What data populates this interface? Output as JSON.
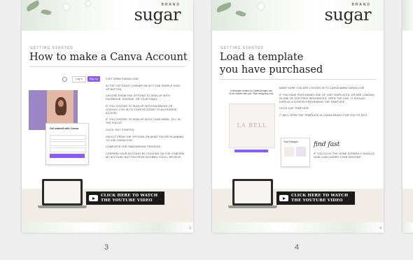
{
  "brand": {
    "small": "BRAND",
    "big": "sugar"
  },
  "pages": [
    {
      "number": "3",
      "section": "GETTING STARTED",
      "title": "How to make a Canva Account",
      "ui_login": "Log in",
      "ui_signup": "Sign up",
      "modal_title": "Get started with Canva",
      "steps": [
        "VISIT WWW.CANVA.COM",
        "IN THE TOP RIGHT CORNER SELECT THE PURPLE SIGN UP BUTTON",
        "CHOOSE FROM THE OPTIONS TO SIGN UP WITH FACEBOOK, GOOGLE, OR YOUR EMAIL",
        "IF YOU CHOOSE TO SIGN UP WITH FACEBOOK OR GOOGLE, LOG IN TO YOUR ACCOUNT TO AUTHORIZE ACCESS",
        "IF YOU CHOOSE TO SIGN UP WITH YOUR EMAIL, FILL IN THE FIELDS",
        "CLICK 'GET STARTED'",
        "SELECT FROM THE OPTIONS ON WHAT YOU'RE PLANNING TO USE CANVA FOR",
        "COMPLETE THE ONBOARDING PROCESS",
        "CONFIRM YOUR ACCOUNT BY CLICKING ON THE CONFIRM MY ACCOUNT BUTTON FROM AN EMAIL YOU'LL RECEIVE"
      ],
      "video_line1": "CLICK HERE TO WATCH",
      "video_line2": "THE YOUTUBE VIDEO",
      "corner": "3"
    },
    {
      "number": "4",
      "section": "GETTING STARTED",
      "title_line1": "Load a template",
      "title_line2": "you have purchased",
      "template_note": "A template created by SubtleDesigns can do an shared with you. Start designing now.",
      "template_logo": "LA BELL",
      "your_designs": "Your Designs",
      "script_text": "find fast",
      "steps": [
        "MAKE SURE YOU ARE LOGGED IN TO CANVA WWW.CANVA.COM",
        "IF YOU HAVE PURCHASED ONE OF OUR TEMPLATES, OR ARE LOADING IN ONE OF OUR FREE RESOURCES, OPEN THE LINK. IT SHOULD DISPLAY A SCREEN PREVIEWING THE TEMPLATE",
        "CLICK USE TEMPLATE",
        "IT WILL OPEN THE TEMPLATE IN CANVA READY FOR YOU TO EDIT"
      ],
      "steps_lower": [
        "IF YOU CLICK THE HOME SCREEN IT SHOULD NOW LOAD UNDER YOUR DESIGNS"
      ],
      "video_line1": "CLICK HERE TO WATCH",
      "video_line2": "THE YOUTUBE VIDEO",
      "corner": "4"
    }
  ],
  "colors": {
    "accent": "#8b5cf6",
    "footer": "#f1ece5",
    "label": "#c6a6a8"
  }
}
